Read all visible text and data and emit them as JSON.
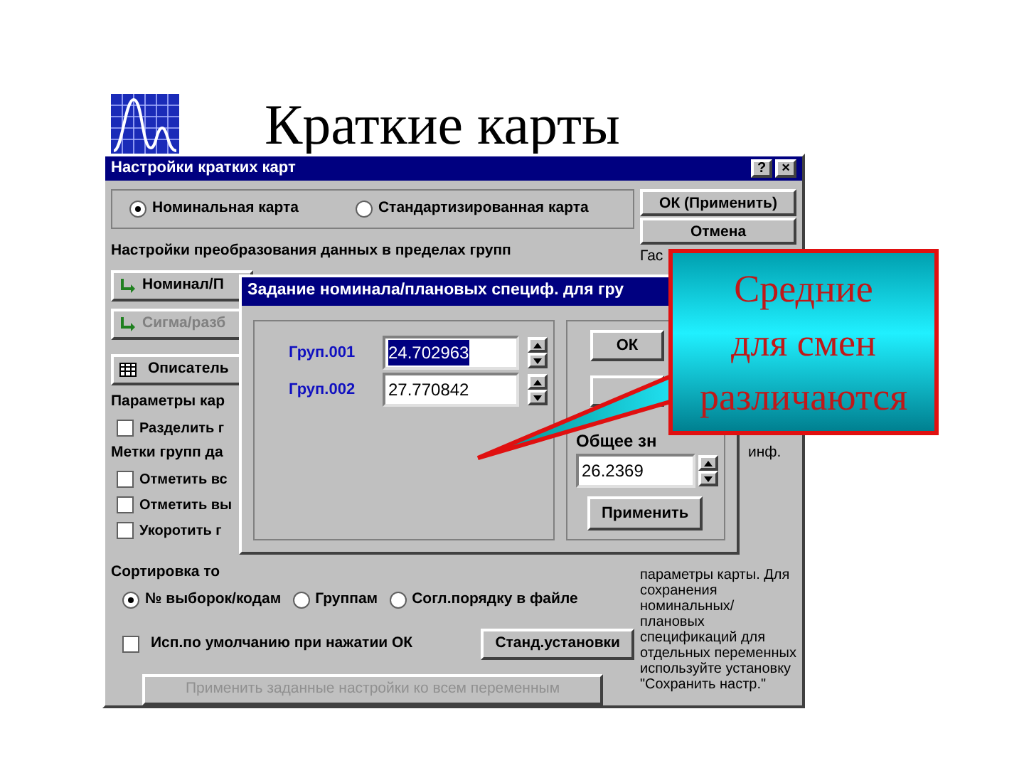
{
  "slide": {
    "title": "Краткие карты"
  },
  "main_dialog": {
    "title": "Настройки кратких карт",
    "title_buttons": [
      "?",
      "×"
    ],
    "chart_type_radios": [
      {
        "label": "Номинальная карта",
        "selected": true
      },
      {
        "label": "Стандартизированная карта",
        "selected": false
      }
    ],
    "side_buttons": [
      "ОК (Применить)",
      "Отмена"
    ],
    "side_text_partial": "Гас",
    "transform_group": {
      "label": "Настройки преобразования данных в пределах групп",
      "buttons": [
        {
          "label": "Номинал/П",
          "disabled": false
        },
        {
          "label": "Сигма/разб",
          "disabled": true
        }
      ]
    },
    "descriptor_button": "Описатель",
    "params_group": {
      "label": "Параметры кар",
      "checkboxes": [
        {
          "label": "Разделить г",
          "checked": false
        }
      ]
    },
    "marks_group": {
      "label": "Метки групп да",
      "checkboxes": [
        {
          "label": "Отметить вс",
          "checked": false
        },
        {
          "label": "Отметить вы",
          "checked": false
        },
        {
          "label": "Укоротить г",
          "checked": false
        }
      ]
    },
    "sort_group": {
      "label": "Сортировка то",
      "radios": [
        {
          "label": "№ выборок/кодам",
          "selected": true
        },
        {
          "label": "Группам",
          "selected": false
        },
        {
          "label": "Согл.порядку в файле",
          "selected": false
        }
      ]
    },
    "default_checkbox": {
      "label": "Исп.по умолчанию при нажатии ОК",
      "checked": false
    },
    "std_button": "Станд.установки",
    "apply_all_button": {
      "label": "Применить заданные настройки ко всем переменным",
      "disabled": true
    },
    "help_partial": "инф.",
    "help_text": [
      "параметры карты. Для",
      "сохранения",
      "номинальных/",
      "плановых",
      "спецификаций для",
      "отдельных переменных",
      "используйте установку",
      "\"Сохранить настр.\""
    ]
  },
  "nested_dialog": {
    "title": "Задание номинала/плановых специф. для гру",
    "groups": [
      {
        "label": "Груп.001",
        "value": "24.702963",
        "selected": true
      },
      {
        "label": "Груп.002",
        "value": "27.770842",
        "selected": false
      }
    ],
    "ok_button": "ОК",
    "overall_label": "Общее зн",
    "overall_value": "26.2369",
    "apply_button": "Применить"
  },
  "callout": {
    "lines": [
      "Средние",
      "для смен",
      "различаются"
    ]
  }
}
